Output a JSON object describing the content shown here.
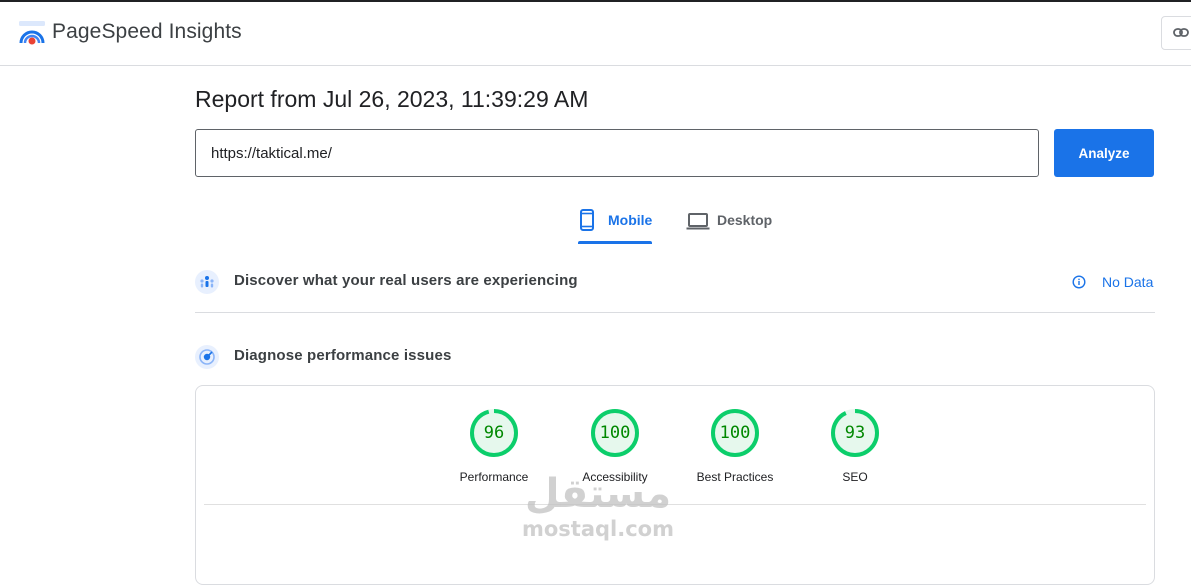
{
  "app": {
    "title": "PageSpeed Insights",
    "logo_icon": "pagespeed-logo-icon",
    "share_icon": "link-icon"
  },
  "report": {
    "title": "Report from Jul 26, 2023, 11:39:29 AM",
    "url_value": "https://taktical.me/",
    "analyze_label": "Analyze"
  },
  "tabs": [
    {
      "label": "Mobile",
      "icon": "smartphone-icon",
      "active": true
    },
    {
      "label": "Desktop",
      "icon": "laptop-icon",
      "active": false
    }
  ],
  "field_section": {
    "title": "Discover what your real users are experiencing",
    "icon": "users-icon",
    "status_icon": "info-icon",
    "status_label": "No Data"
  },
  "lab_section": {
    "title": "Diagnose performance issues",
    "icon": "gauge-icon"
  },
  "scores": [
    {
      "value": 96,
      "label": "Performance"
    },
    {
      "value": 100,
      "label": "Accessibility"
    },
    {
      "value": 100,
      "label": "Best Practices"
    },
    {
      "value": 93,
      "label": "SEO"
    }
  ],
  "watermark": {
    "mark": "مستقل",
    "text": "mostaql.com"
  },
  "colors": {
    "accent": "#1a73e8",
    "score_pass": "#0cce6b",
    "score_pass_bg": "#e6f8ed",
    "score_text": "#008800"
  }
}
